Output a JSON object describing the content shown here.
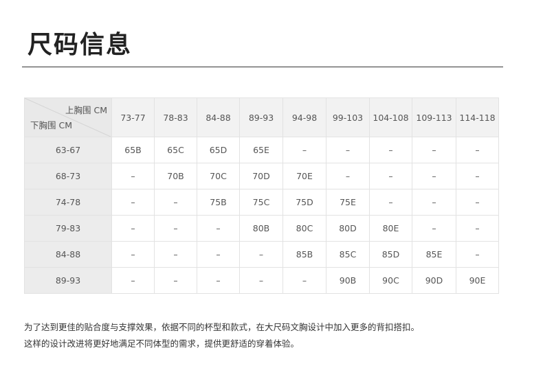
{
  "title": "尺码信息",
  "table": {
    "corner_top": "上胸围 CM",
    "corner_bottom": "下胸围 CM",
    "columns": [
      "73-77",
      "78-83",
      "84-88",
      "89-93",
      "94-98",
      "99-103",
      "104-108",
      "109-113",
      "114-118"
    ],
    "rows": [
      {
        "label": "63-67",
        "cells": [
          "65B",
          "65C",
          "65D",
          "65E",
          "–",
          "–",
          "–",
          "–",
          "–"
        ]
      },
      {
        "label": "68-73",
        "cells": [
          "–",
          "70B",
          "70C",
          "70D",
          "70E",
          "–",
          "–",
          "–",
          "–"
        ]
      },
      {
        "label": "74-78",
        "cells": [
          "–",
          "–",
          "75B",
          "75C",
          "75D",
          "75E",
          "–",
          "–",
          "–"
        ]
      },
      {
        "label": "79-83",
        "cells": [
          "–",
          "–",
          "–",
          "80B",
          "80C",
          "80D",
          "80E",
          "–",
          "–"
        ]
      },
      {
        "label": "84-88",
        "cells": [
          "–",
          "–",
          "–",
          "–",
          "85B",
          "85C",
          "85D",
          "85E",
          "–"
        ]
      },
      {
        "label": "89-93",
        "cells": [
          "–",
          "–",
          "–",
          "–",
          "–",
          "90B",
          "90C",
          "90D",
          "90E"
        ]
      }
    ]
  },
  "notes": [
    "为了达到更佳的贴合度与支撑效果，依据不同的杯型和款式，在大尺码文胸设计中加入更多的背扣搭扣。",
    "这样的设计改进将更好地满足不同体型的需求，提供更舒适的穿着体验。"
  ]
}
